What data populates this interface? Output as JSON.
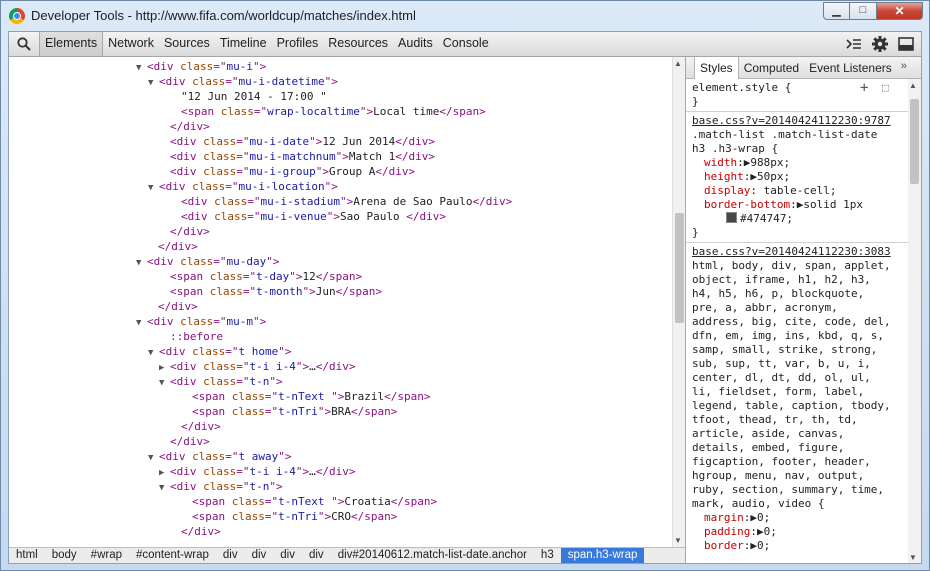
{
  "window": {
    "title": "Developer Tools - http://www.fifa.com/worldcup/matches/index.html",
    "controls": {
      "minimize": "▁",
      "maximize": "□",
      "close": "✕"
    }
  },
  "toolbar": {
    "tabs": [
      "Elements",
      "Network",
      "Sources",
      "Timeline",
      "Profiles",
      "Resources",
      "Audits",
      "Console"
    ],
    "active_tab": "Elements",
    "right_icons": [
      "execute-icon",
      "gear-icon",
      "dock-icon"
    ]
  },
  "elements": {
    "lines": [
      {
        "indent": 140,
        "tri": "▼",
        "tokens": [
          [
            "tag",
            "<div "
          ],
          [
            "an",
            "class"
          ],
          [
            "tag",
            "=\""
          ],
          [
            "av",
            "mu-i"
          ],
          [
            "tag",
            "\">"
          ]
        ]
      },
      {
        "indent": 152,
        "tri": "▼",
        "tokens": [
          [
            "tag",
            "<div "
          ],
          [
            "an",
            "class"
          ],
          [
            "tag",
            "=\""
          ],
          [
            "av",
            "mu-i-datetime"
          ],
          [
            "tag",
            "\">"
          ]
        ]
      },
      {
        "indent": 174,
        "tri": "",
        "tokens": [
          [
            "tx",
            "\"12 Jun 2014 - 17:00 \""
          ]
        ]
      },
      {
        "indent": 174,
        "tri": "",
        "tokens": [
          [
            "tag",
            "<span "
          ],
          [
            "an",
            "class"
          ],
          [
            "tag",
            "=\""
          ],
          [
            "av",
            "wrap-localtime"
          ],
          [
            "tag",
            "\">"
          ],
          [
            "tx",
            "Local time"
          ],
          [
            "tag",
            "</span>"
          ]
        ]
      },
      {
        "indent": 163,
        "tri": "",
        "tokens": [
          [
            "tag",
            "</div>"
          ]
        ]
      },
      {
        "indent": 163,
        "tri": "",
        "tokens": [
          [
            "tag",
            "<div "
          ],
          [
            "an",
            "class"
          ],
          [
            "tag",
            "=\""
          ],
          [
            "av",
            "mu-i-date"
          ],
          [
            "tag",
            "\">"
          ],
          [
            "tx",
            "12 Jun 2014"
          ],
          [
            "tag",
            "</div>"
          ]
        ]
      },
      {
        "indent": 163,
        "tri": "",
        "tokens": [
          [
            "tag",
            "<div "
          ],
          [
            "an",
            "class"
          ],
          [
            "tag",
            "=\""
          ],
          [
            "av",
            "mu-i-matchnum"
          ],
          [
            "tag",
            "\">"
          ],
          [
            "tx",
            "Match 1"
          ],
          [
            "tag",
            "</div>"
          ]
        ]
      },
      {
        "indent": 163,
        "tri": "",
        "tokens": [
          [
            "tag",
            "<div "
          ],
          [
            "an",
            "class"
          ],
          [
            "tag",
            "=\""
          ],
          [
            "av",
            "mu-i-group"
          ],
          [
            "tag",
            "\">"
          ],
          [
            "tx",
            "Group A"
          ],
          [
            "tag",
            "</div>"
          ]
        ]
      },
      {
        "indent": 152,
        "tri": "▼",
        "tokens": [
          [
            "tag",
            "<div "
          ],
          [
            "an",
            "class"
          ],
          [
            "tag",
            "=\""
          ],
          [
            "av",
            "mu-i-location"
          ],
          [
            "tag",
            "\">"
          ]
        ]
      },
      {
        "indent": 174,
        "tri": "",
        "tokens": [
          [
            "tag",
            "<div "
          ],
          [
            "an",
            "class"
          ],
          [
            "tag",
            "=\""
          ],
          [
            "av",
            "mu-i-stadium"
          ],
          [
            "tag",
            "\">"
          ],
          [
            "tx",
            "Arena de Sao Paulo"
          ],
          [
            "tag",
            "</div>"
          ]
        ]
      },
      {
        "indent": 174,
        "tri": "",
        "tokens": [
          [
            "tag",
            "<div "
          ],
          [
            "an",
            "class"
          ],
          [
            "tag",
            "=\""
          ],
          [
            "av",
            "mu-i-venue"
          ],
          [
            "tag",
            "\">"
          ],
          [
            "tx",
            "Sao Paulo "
          ],
          [
            "tag",
            "</div>"
          ]
        ]
      },
      {
        "indent": 163,
        "tri": "",
        "tokens": [
          [
            "tag",
            "</div>"
          ]
        ]
      },
      {
        "indent": 151,
        "tri": "",
        "tokens": [
          [
            "tag",
            "</div>"
          ]
        ]
      },
      {
        "indent": 140,
        "tri": "▼",
        "tokens": [
          [
            "tag",
            "<div "
          ],
          [
            "an",
            "class"
          ],
          [
            "tag",
            "=\""
          ],
          [
            "av",
            "mu-day"
          ],
          [
            "tag",
            "\">"
          ]
        ]
      },
      {
        "indent": 163,
        "tri": "",
        "tokens": [
          [
            "tag",
            "<span "
          ],
          [
            "an",
            "class"
          ],
          [
            "tag",
            "=\""
          ],
          [
            "av",
            "t-day"
          ],
          [
            "tag",
            "\">"
          ],
          [
            "tx",
            "12"
          ],
          [
            "tag",
            "</span>"
          ]
        ]
      },
      {
        "indent": 163,
        "tri": "",
        "tokens": [
          [
            "tag",
            "<span "
          ],
          [
            "an",
            "class"
          ],
          [
            "tag",
            "=\""
          ],
          [
            "av",
            "t-month"
          ],
          [
            "tag",
            "\">"
          ],
          [
            "tx",
            "Jun"
          ],
          [
            "tag",
            "</span>"
          ]
        ]
      },
      {
        "indent": 151,
        "tri": "",
        "tokens": [
          [
            "tag",
            "</div>"
          ]
        ]
      },
      {
        "indent": 140,
        "tri": "▼",
        "tokens": [
          [
            "tag",
            "<div "
          ],
          [
            "an",
            "class"
          ],
          [
            "tag",
            "=\""
          ],
          [
            "av",
            "mu-m"
          ],
          [
            "tag",
            "\">"
          ]
        ]
      },
      {
        "indent": 163,
        "tri": "",
        "tokens": [
          [
            "tag",
            "::before"
          ]
        ]
      },
      {
        "indent": 152,
        "tri": "▼",
        "tokens": [
          [
            "tag",
            "<div "
          ],
          [
            "an",
            "class"
          ],
          [
            "tag",
            "=\""
          ],
          [
            "av",
            "t home"
          ],
          [
            "tag",
            "\">"
          ]
        ]
      },
      {
        "indent": 163,
        "tri": "▶",
        "tokens": [
          [
            "tag",
            "<div "
          ],
          [
            "an",
            "class"
          ],
          [
            "tag",
            "=\""
          ],
          [
            "av",
            "t-i i-4"
          ],
          [
            "tag",
            "\">"
          ],
          [
            "tx",
            "…"
          ],
          [
            "tag",
            "</div>"
          ]
        ]
      },
      {
        "indent": 163,
        "tri": "▼",
        "tokens": [
          [
            "tag",
            "<div "
          ],
          [
            "an",
            "class"
          ],
          [
            "tag",
            "=\""
          ],
          [
            "av",
            "t-n"
          ],
          [
            "tag",
            "\">"
          ]
        ]
      },
      {
        "indent": 185,
        "tri": "",
        "tokens": [
          [
            "tag",
            "<span "
          ],
          [
            "an",
            "class"
          ],
          [
            "tag",
            "=\""
          ],
          [
            "av",
            "t-nText "
          ],
          [
            "tag",
            "\">"
          ],
          [
            "tx",
            "Brazil"
          ],
          [
            "tag",
            "</span>"
          ]
        ]
      },
      {
        "indent": 185,
        "tri": "",
        "tokens": [
          [
            "tag",
            "<span "
          ],
          [
            "an",
            "class"
          ],
          [
            "tag",
            "=\""
          ],
          [
            "av",
            "t-nTri"
          ],
          [
            "tag",
            "\">"
          ],
          [
            "tx",
            "BRA"
          ],
          [
            "tag",
            "</span>"
          ]
        ]
      },
      {
        "indent": 174,
        "tri": "",
        "tokens": [
          [
            "tag",
            "</div>"
          ]
        ]
      },
      {
        "indent": 163,
        "tri": "",
        "tokens": [
          [
            "tag",
            "</div>"
          ]
        ]
      },
      {
        "indent": 152,
        "tri": "▼",
        "tokens": [
          [
            "tag",
            "<div "
          ],
          [
            "an",
            "class"
          ],
          [
            "tag",
            "=\""
          ],
          [
            "av",
            "t away"
          ],
          [
            "tag",
            "\">"
          ]
        ]
      },
      {
        "indent": 163,
        "tri": "▶",
        "tokens": [
          [
            "tag",
            "<div "
          ],
          [
            "an",
            "class"
          ],
          [
            "tag",
            "=\""
          ],
          [
            "av",
            "t-i i-4"
          ],
          [
            "tag",
            "\">"
          ],
          [
            "tx",
            "…"
          ],
          [
            "tag",
            "</div>"
          ]
        ]
      },
      {
        "indent": 163,
        "tri": "▼",
        "tokens": [
          [
            "tag",
            "<div "
          ],
          [
            "an",
            "class"
          ],
          [
            "tag",
            "=\""
          ],
          [
            "av",
            "t-n"
          ],
          [
            "tag",
            "\">"
          ]
        ]
      },
      {
        "indent": 185,
        "tri": "",
        "tokens": [
          [
            "tag",
            "<span "
          ],
          [
            "an",
            "class"
          ],
          [
            "tag",
            "=\""
          ],
          [
            "av",
            "t-nText "
          ],
          [
            "tag",
            "\">"
          ],
          [
            "tx",
            "Croatia"
          ],
          [
            "tag",
            "</span>"
          ]
        ]
      },
      {
        "indent": 185,
        "tri": "",
        "tokens": [
          [
            "tag",
            "<span "
          ],
          [
            "an",
            "class"
          ],
          [
            "tag",
            "=\""
          ],
          [
            "av",
            "t-nTri"
          ],
          [
            "tag",
            "\">"
          ],
          [
            "tx",
            "CRO"
          ],
          [
            "tag",
            "</span>"
          ]
        ]
      },
      {
        "indent": 174,
        "tri": "",
        "tokens": [
          [
            "tag",
            "</div>"
          ]
        ]
      }
    ]
  },
  "breadcrumbs": [
    "html",
    "body",
    "#wrap",
    "#content-wrap",
    "div",
    "div",
    "div",
    "div",
    "div#20140612.match-list-date.anchor",
    "h3",
    "span.h3-wrap"
  ],
  "selected_crumb": "span.h3-wrap",
  "sidebar": {
    "tabs": [
      "Styles",
      "Computed",
      "Event Listeners"
    ],
    "active_tab": "Styles",
    "more": "»",
    "element_style": {
      "selector": "element.style {",
      "close": "}"
    },
    "rule1": {
      "source": "base.css?v=20140424112230:9787",
      "selector_lines": [
        ".match-list .match-list-date",
        "h3 .h3-wrap {"
      ],
      "props": [
        {
          "name": "width",
          "value": "988px;",
          "arrow": true
        },
        {
          "name": "height",
          "value": "50px;",
          "arrow": true
        },
        {
          "name": "display",
          "value": "table-cell;",
          "arrow": false
        },
        {
          "name": "border-bottom",
          "value": "solid 1px",
          "arrow": true
        }
      ],
      "color_value": "#474747;",
      "close": "}"
    },
    "rule2": {
      "source": "base.css?v=20140424112230:3083",
      "selector_lines": [
        "html, body, div, span, applet,",
        "object, iframe, h1, h2, h3,",
        "h4, h5, h6, p, blockquote,",
        "pre, a, abbr, acronym,",
        "address, big, cite, code, del,",
        "dfn, em, img, ins, kbd, q, s,",
        "samp, small, strike, strong,",
        "sub, sup, tt, var, b, u, i,",
        "center, dl, dt, dd, ol, ul,",
        "li, fieldset, form, label,",
        "legend, table, caption, tbody,",
        "tfoot, thead, tr, th, td,",
        "article, aside, canvas,",
        "details, embed, figure,",
        "figcaption, footer, header,",
        "hgroup, menu, nav, output,",
        "ruby, section, summary, time,",
        "mark, audio, video {"
      ],
      "props": [
        {
          "name": "margin",
          "value": "0;",
          "arrow": true
        },
        {
          "name": "padding",
          "value": "0;",
          "arrow": true
        },
        {
          "name": "border",
          "value": "0;",
          "arrow": true
        }
      ]
    }
  }
}
